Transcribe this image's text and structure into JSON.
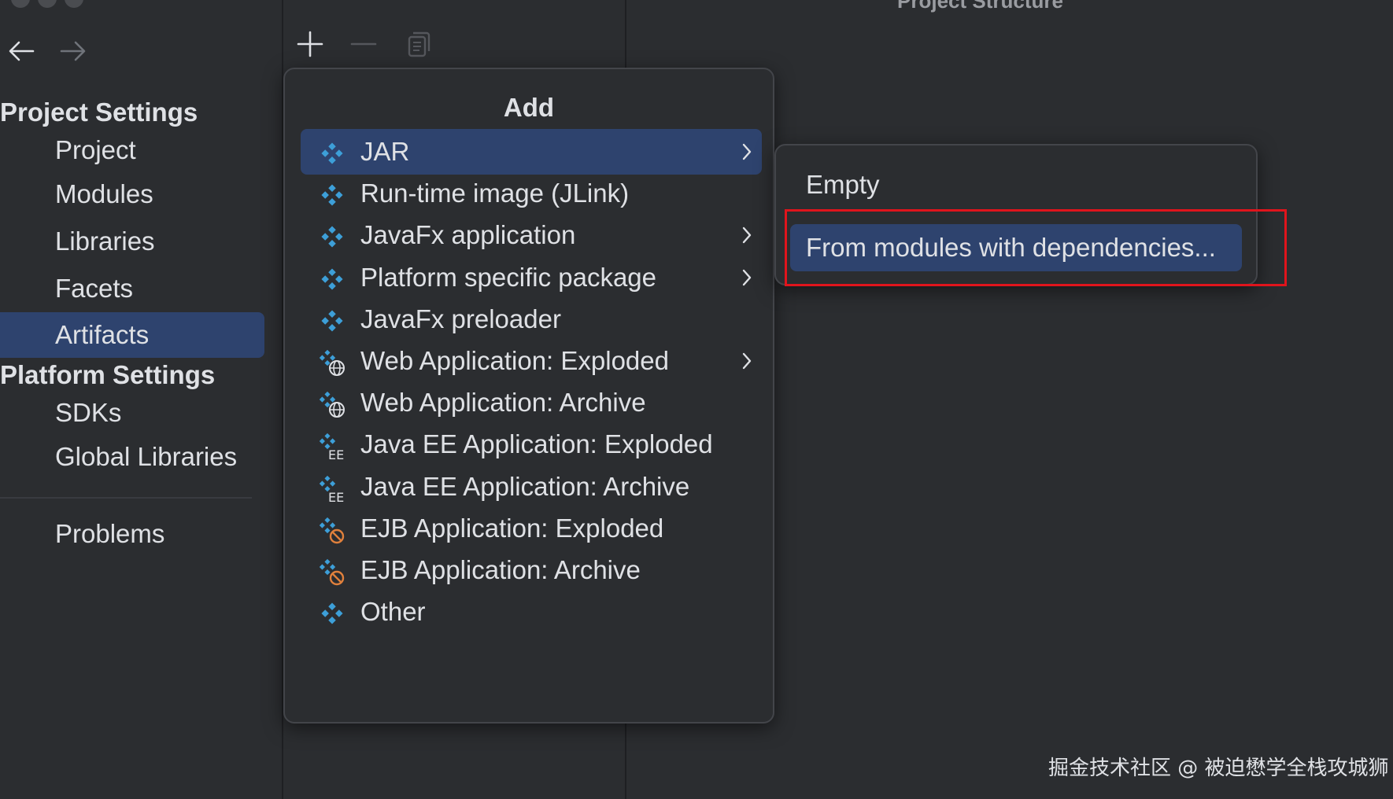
{
  "window": {
    "title": "Project Structure"
  },
  "toolbar": {
    "back_icon": "arrow-left-icon",
    "forward_icon": "arrow-right-icon"
  },
  "sidebar": {
    "project_settings_header": "Project Settings",
    "project_items": [
      "Project",
      "Modules",
      "Libraries",
      "Facets",
      "Artifacts"
    ],
    "selected": "Artifacts",
    "platform_settings_header": "Platform Settings",
    "platform_items": [
      "SDKs",
      "Global Libraries"
    ],
    "problems": "Problems"
  },
  "list_toolbar": {
    "add_icon": "plus-icon",
    "remove_icon": "minus-icon",
    "copy_icon": "copy-icon"
  },
  "add_popup": {
    "title": "Add",
    "items": [
      {
        "label": "JAR",
        "icon": "artifact-icon",
        "submenu": true,
        "selected": true
      },
      {
        "label": "Run-time image (JLink)",
        "icon": "artifact-icon",
        "submenu": false
      },
      {
        "label": "JavaFx application",
        "icon": "artifact-icon",
        "submenu": true
      },
      {
        "label": "Platform specific package",
        "icon": "artifact-icon",
        "submenu": true
      },
      {
        "label": "JavaFx preloader",
        "icon": "artifact-icon",
        "submenu": false
      },
      {
        "label": "Web Application: Exploded",
        "icon": "web-artifact-icon",
        "submenu": true
      },
      {
        "label": "Web Application: Archive",
        "icon": "web-artifact-icon",
        "submenu": false
      },
      {
        "label": "Java EE Application: Exploded",
        "icon": "javaee-artifact-icon",
        "submenu": false
      },
      {
        "label": "Java EE Application: Archive",
        "icon": "javaee-artifact-icon",
        "submenu": false
      },
      {
        "label": "EJB Application: Exploded",
        "icon": "ejb-artifact-icon",
        "submenu": false
      },
      {
        "label": "EJB Application: Archive",
        "icon": "ejb-artifact-icon",
        "submenu": false
      },
      {
        "label": "Other",
        "icon": "artifact-icon",
        "submenu": false
      }
    ]
  },
  "jar_submenu": {
    "items": [
      {
        "label": "Empty",
        "selected": false
      },
      {
        "label": "From modules with dependencies...",
        "selected": true
      }
    ]
  },
  "watermark": "掘金技术社区 @ 被迫懋学全栈攻城狮",
  "colors": {
    "background": "#2b2d30",
    "selection": "#2e436e",
    "accent_icon": "#3d9fd8",
    "highlight_box": "#e0141c",
    "text": "#dfe1e5"
  }
}
